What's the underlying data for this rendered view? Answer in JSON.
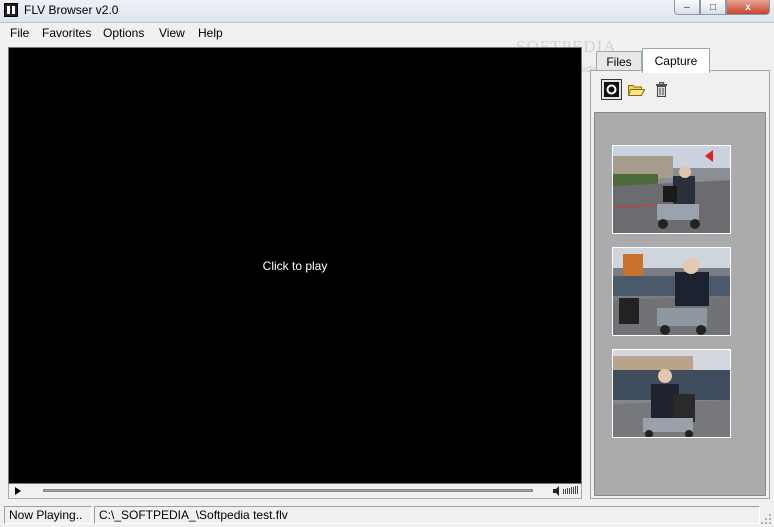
{
  "window": {
    "title": "FLV Browser v2.0",
    "buttons": {
      "minimize": "–",
      "maximize": "□",
      "close": "x"
    }
  },
  "menu": [
    "File",
    "Favorites",
    "Options",
    "View",
    "Help"
  ],
  "watermark": {
    "text": "SOFTPEDIA",
    "url": "www.softpedia"
  },
  "player": {
    "prompt": "Click to play",
    "seek_progress": 0.0
  },
  "tabs": [
    {
      "label": "Files",
      "active": false
    },
    {
      "label": "Capture",
      "active": true
    }
  ],
  "capture_toolbar": [
    {
      "icon": "capture-icon",
      "selected": true
    },
    {
      "icon": "open-folder-icon",
      "selected": false
    },
    {
      "icon": "trash-icon",
      "selected": false
    }
  ],
  "thumbnails": [
    {
      "icon": "video-frame-thumbnail"
    },
    {
      "icon": "video-frame-thumbnail"
    },
    {
      "icon": "video-frame-thumbnail"
    }
  ],
  "status": {
    "state": "Now Playing..",
    "path": "C:\\_SOFTPEDIA_\\Softpedia test.flv"
  },
  "colors": {
    "video_bg": "#000000",
    "thumb_list_bg": "#ababab",
    "close_button": "#c7432c"
  }
}
